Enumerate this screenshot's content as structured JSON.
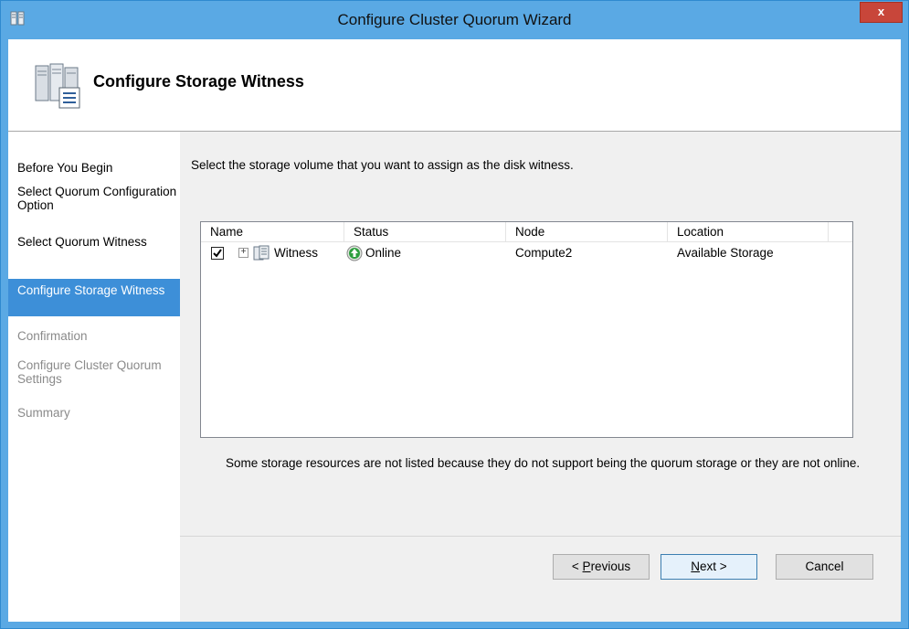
{
  "window": {
    "title": "Configure Cluster Quorum Wizard",
    "close_label": "x"
  },
  "header": {
    "title": "Configure Storage Witness"
  },
  "sidebar": {
    "items": [
      {
        "label": "Before You Begin",
        "state": "completed"
      },
      {
        "label": "Select Quorum Configuration Option",
        "state": "completed"
      },
      {
        "label": "Select Quorum Witness",
        "state": "completed"
      },
      {
        "label": "Configure Storage Witness",
        "state": "active"
      },
      {
        "label": "Confirmation",
        "state": "disabled"
      },
      {
        "label": "Configure Cluster Quorum Settings",
        "state": "disabled"
      },
      {
        "label": "Summary",
        "state": "disabled"
      }
    ]
  },
  "main": {
    "instruction": "Select the storage volume that you want to assign as the disk witness.",
    "table": {
      "columns": [
        "Name",
        "Status",
        "Node",
        "Location"
      ],
      "rows": [
        {
          "checked": true,
          "name": "Witness",
          "status": "Online",
          "node": "Compute2",
          "location": "Available Storage"
        }
      ]
    },
    "note": "Some storage resources are not listed because they do not support being the quorum storage or they are not online."
  },
  "buttons": {
    "previous_pre": "< ",
    "previous_key": "P",
    "previous_post": "revious",
    "next_key": "N",
    "next_post": "ext >",
    "cancel": "Cancel"
  },
  "colors": {
    "title_bar": "#5aa9e4",
    "selected_step": "#3d8fd8",
    "status_online": "#2e9e3e"
  },
  "icons": {
    "app": "cluster-icon",
    "header": "storage-witness-icon",
    "disk": "disk-icon",
    "status": "online-status-icon"
  }
}
